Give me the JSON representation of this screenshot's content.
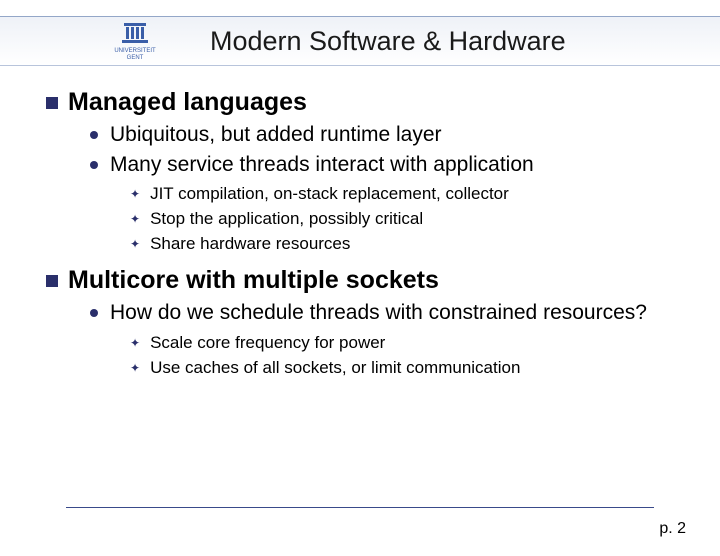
{
  "header": {
    "logo_text_top": "UNIVERSITEIT",
    "logo_text_bottom": "GENT",
    "title": "Modern Software & Hardware"
  },
  "sections": [
    {
      "heading": "Managed languages",
      "items": [
        {
          "text": "Ubiquitous, but added runtime layer"
        },
        {
          "text": "Many service threads interact with application",
          "sub": [
            "JIT compilation, on-stack replacement, collector",
            "Stop the application, possibly critical",
            "Share hardware resources"
          ]
        }
      ]
    },
    {
      "heading": "Multicore with multiple sockets",
      "items": [
        {
          "text": "How do we schedule threads with constrained resources?",
          "sub": [
            "Scale core frequency for power",
            "Use caches of all sockets, or limit communication"
          ]
        }
      ]
    }
  ],
  "footer": {
    "page": "p. 2"
  }
}
